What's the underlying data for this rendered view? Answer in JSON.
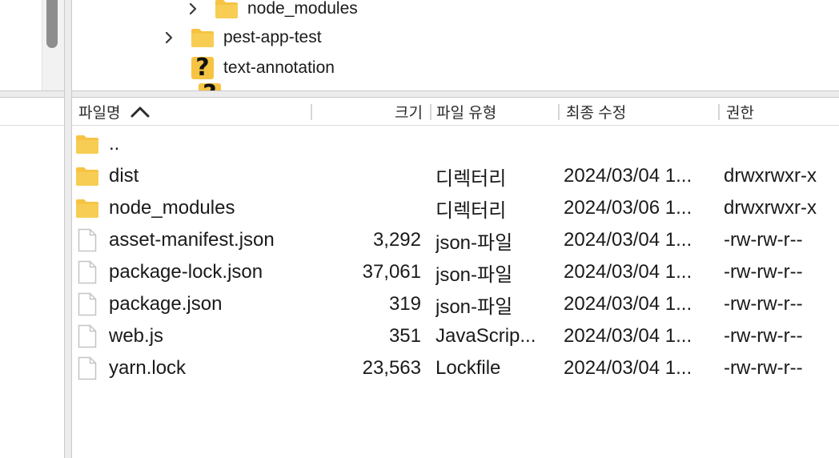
{
  "tree": {
    "items": [
      {
        "label": "node_modules",
        "icon": "folder-icon",
        "expandable": true
      },
      {
        "label": "pest-app-test",
        "icon": "folder-icon",
        "expandable": true
      },
      {
        "label": "text-annotation",
        "icon": "unknown-icon",
        "expandable": false
      }
    ],
    "unknown_glyph": "?"
  },
  "filelist": {
    "columns": {
      "name": "파일명",
      "size": "크기",
      "type": "파일 유형",
      "modified": "최종 수정",
      "permissions": "권한"
    },
    "sort": {
      "column": "name",
      "direction": "ascending"
    },
    "rows": [
      {
        "icon": "folder-icon",
        "name": "..",
        "size": "",
        "type": "",
        "modified": "",
        "permissions": ""
      },
      {
        "icon": "folder-icon",
        "name": "dist",
        "size": "",
        "type": "디렉터리",
        "modified": "2024/03/04 1...",
        "permissions": "drwxrwxr-x"
      },
      {
        "icon": "folder-icon",
        "name": "node_modules",
        "size": "",
        "type": "디렉터리",
        "modified": "2024/03/06 1...",
        "permissions": "drwxrwxr-x"
      },
      {
        "icon": "file-icon",
        "name": "asset-manifest.json",
        "size": "3,292",
        "type": "json-파일",
        "modified": "2024/03/04 1...",
        "permissions": "-rw-rw-r--"
      },
      {
        "icon": "file-icon",
        "name": "package-lock.json",
        "size": "37,061",
        "type": "json-파일",
        "modified": "2024/03/04 1...",
        "permissions": "-rw-rw-r--"
      },
      {
        "icon": "file-icon",
        "name": "package.json",
        "size": "319",
        "type": "json-파일",
        "modified": "2024/03/04 1...",
        "permissions": "-rw-rw-r--"
      },
      {
        "icon": "file-icon",
        "name": "web.js",
        "size": "351",
        "type": "JavaScrip...",
        "modified": "2024/03/04 1...",
        "permissions": "-rw-rw-r--"
      },
      {
        "icon": "file-icon",
        "name": "yarn.lock",
        "size": "23,563",
        "type": "Lockfile",
        "modified": "2024/03/04 1...",
        "permissions": "-rw-rw-r--"
      }
    ]
  },
  "colors": {
    "folder": "#f6c343",
    "folder_tab": "#e8b032",
    "file_border": "#c4c4c4"
  }
}
